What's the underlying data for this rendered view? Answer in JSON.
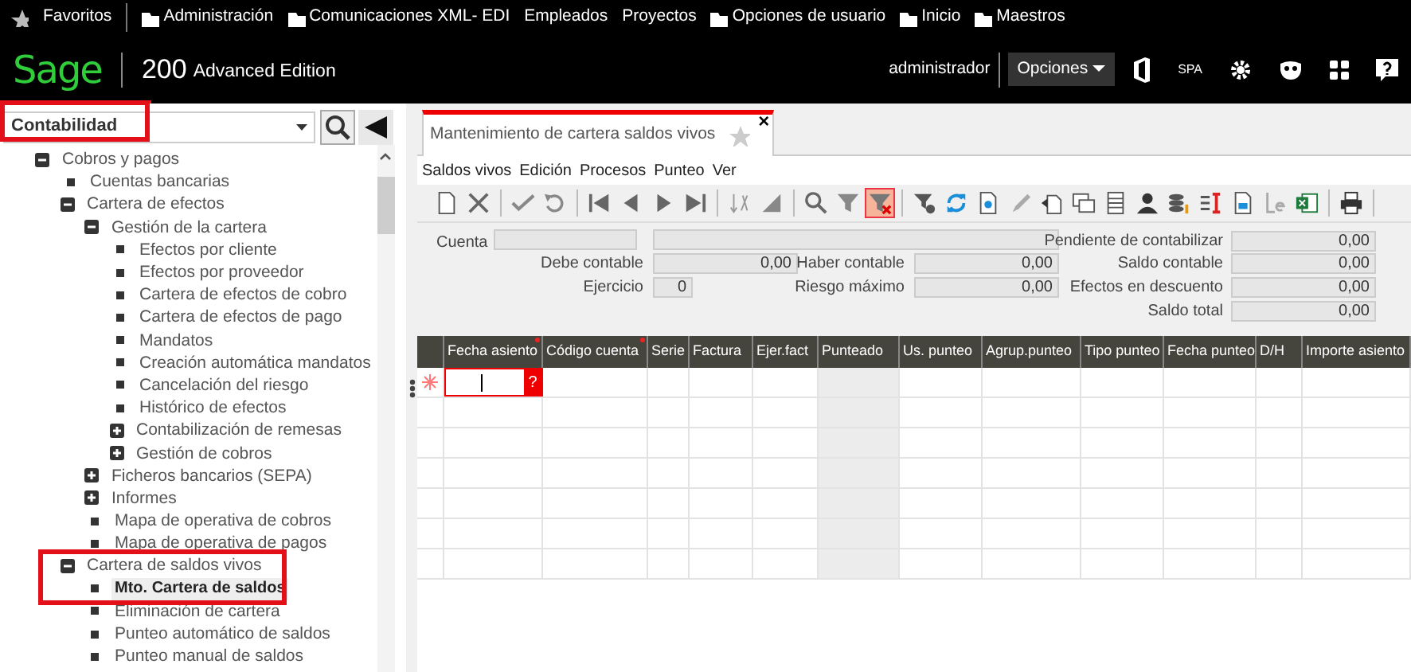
{
  "favorites_bar": {
    "label": "Favoritos",
    "links": [
      {
        "label": "Administración",
        "kind": "folder"
      },
      {
        "label": "Comunicaciones XML- EDI",
        "kind": "folder"
      },
      {
        "label": "Empleados",
        "kind": "link"
      },
      {
        "label": "Proyectos",
        "kind": "link"
      },
      {
        "label": "Opciones de usuario",
        "kind": "folder"
      },
      {
        "label": "Inicio",
        "kind": "folder"
      },
      {
        "label": "Maestros",
        "kind": "folder"
      }
    ]
  },
  "header": {
    "logo": "Sage",
    "product": "200",
    "edition": "Advanced Edition",
    "user": "administrador",
    "options_button": "Opciones",
    "language": "SPA"
  },
  "sidebar": {
    "module": "Contabilidad",
    "module_highlighted": true,
    "tree": [
      {
        "label": "Cobros y pagos",
        "kind": "folder",
        "expanded": true,
        "selected": false,
        "children": [
          {
            "label": "Cuentas bancarias",
            "kind": "leaf",
            "selected": false,
            "highlighted": false
          },
          {
            "label": "Cartera de efectos",
            "kind": "folder",
            "expanded": true,
            "selected": false,
            "highlighted": false,
            "children": [
              {
                "label": "Gestión de la cartera",
                "kind": "folder",
                "expanded": true,
                "selected": false,
                "children": [
                  {
                    "label": "Efectos por cliente",
                    "kind": "leaf",
                    "selected": false
                  },
                  {
                    "label": "Efectos por proveedor",
                    "kind": "leaf",
                    "selected": false
                  },
                  {
                    "label": "Cartera de efectos de cobro",
                    "kind": "leaf",
                    "selected": false
                  },
                  {
                    "label": "Cartera de efectos de pago",
                    "kind": "leaf",
                    "selected": false
                  },
                  {
                    "label": "Mandatos",
                    "kind": "leaf",
                    "selected": false
                  },
                  {
                    "label": "Creación automática mandatos",
                    "kind": "leaf",
                    "selected": false
                  },
                  {
                    "label": "Cancelación del riesgo",
                    "kind": "leaf",
                    "selected": false
                  },
                  {
                    "label": "Histórico de efectos",
                    "kind": "leaf",
                    "selected": false
                  },
                  {
                    "label": "Contabilización de remesas",
                    "kind": "folder",
                    "expanded": false,
                    "selected": false
                  },
                  {
                    "label": "Gestión de cobros",
                    "kind": "folder",
                    "expanded": false,
                    "selected": false
                  }
                ]
              },
              {
                "label": "Ficheros bancarios (SEPA)",
                "kind": "folder",
                "expanded": false,
                "selected": false
              },
              {
                "label": "Informes",
                "kind": "folder",
                "expanded": false,
                "selected": false
              },
              {
                "label": "Mapa de operativa de cobros",
                "kind": "leaf",
                "selected": false
              },
              {
                "label": "Mapa de operativa de pagos",
                "kind": "leaf",
                "selected": false
              }
            ]
          },
          {
            "label": "Cartera de saldos vivos",
            "kind": "folder",
            "expanded": true,
            "selected": false,
            "highlighted": true,
            "children": [
              {
                "label": "Mto. Cartera de saldos",
                "kind": "leaf",
                "selected": true
              },
              {
                "label": "Eliminación de cartera",
                "kind": "leaf",
                "selected": false
              },
              {
                "label": "Punteo automático de saldos",
                "kind": "leaf",
                "selected": false
              },
              {
                "label": "Punteo manual de saldos",
                "kind": "leaf",
                "selected": false
              }
            ]
          }
        ]
      }
    ]
  },
  "tab": {
    "title": "Mantenimiento de cartera saldos vivos",
    "close": "×"
  },
  "menu": [
    {
      "label": "Saldos vivos"
    },
    {
      "label": "Edición"
    },
    {
      "label": "Procesos"
    },
    {
      "label": "Punteo"
    },
    {
      "label": "Ver"
    }
  ],
  "toolbar": {
    "clear_filter_active": true
  },
  "form": {
    "account_label": "Cuenta",
    "left": [
      {
        "label": "Debe contable",
        "value": "0,00"
      },
      {
        "label": "Ejercicio",
        "value": "0"
      }
    ],
    "middle": [
      {
        "label": "Haber contable",
        "value": "0,00"
      },
      {
        "label": "Riesgo máximo",
        "value": "0,00"
      }
    ],
    "right": [
      {
        "label": "Pendiente de contabilizar",
        "value": "0,00"
      },
      {
        "label": "Saldo contable",
        "value": "0,00"
      },
      {
        "label": "Efectos en descuento",
        "value": "0,00"
      },
      {
        "label": "Saldo total",
        "value": "0,00"
      }
    ]
  },
  "table": {
    "columns": [
      {
        "label": "Fecha asiento",
        "required": true
      },
      {
        "label": "Código cuenta",
        "required": true
      },
      {
        "label": "Serie",
        "required": false
      },
      {
        "label": "Factura",
        "required": false
      },
      {
        "label": "Ejer.fact",
        "required": false
      },
      {
        "label": "Punteado",
        "required": false
      },
      {
        "label": "Us. punteo",
        "required": false
      },
      {
        "label": "Agrup.punteo",
        "required": false
      },
      {
        "label": "Tipo punteo",
        "required": false
      },
      {
        "label": "Fecha punteo",
        "required": false
      },
      {
        "label": "D/H",
        "required": false
      },
      {
        "label": "Importe asiento",
        "required": false
      }
    ],
    "lookup_button": "?"
  }
}
